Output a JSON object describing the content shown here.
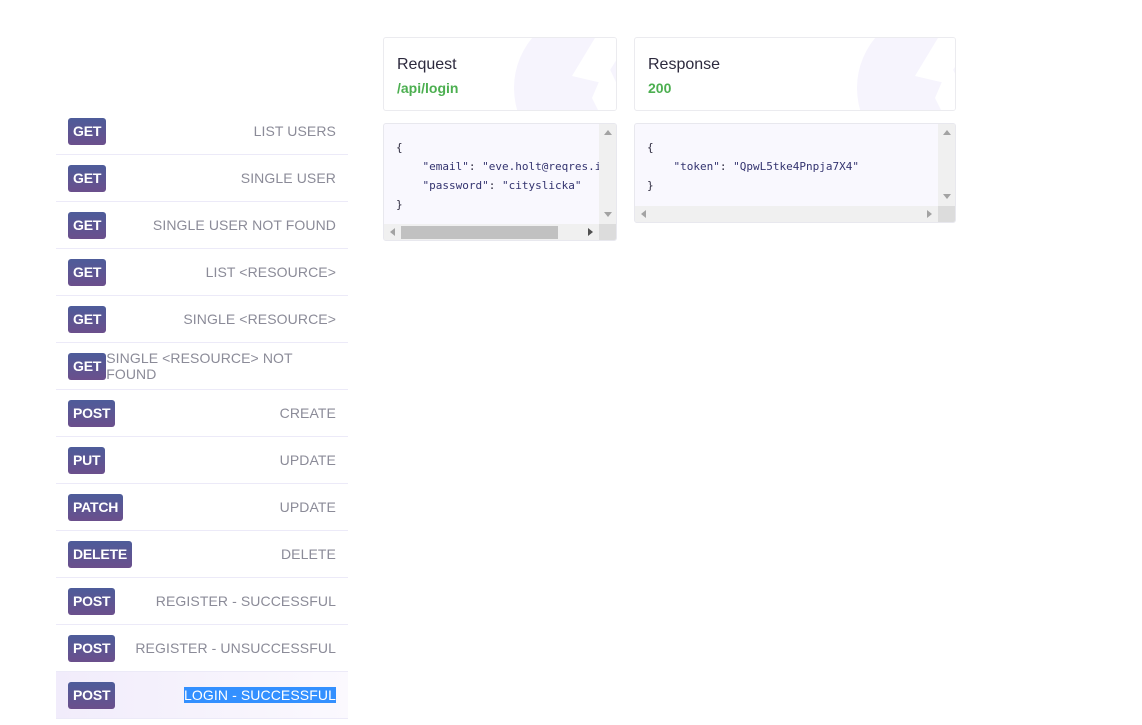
{
  "endpoints": [
    {
      "method": "GET",
      "label": "LIST USERS"
    },
    {
      "method": "GET",
      "label": "SINGLE USER"
    },
    {
      "method": "GET",
      "label": "SINGLE USER NOT FOUND"
    },
    {
      "method": "GET",
      "label": "LIST <RESOURCE>"
    },
    {
      "method": "GET",
      "label": "SINGLE <RESOURCE>"
    },
    {
      "method": "GET",
      "label": "SINGLE <RESOURCE> NOT FOUND"
    },
    {
      "method": "POST",
      "label": "CREATE"
    },
    {
      "method": "PUT",
      "label": "UPDATE"
    },
    {
      "method": "PATCH",
      "label": "UPDATE"
    },
    {
      "method": "DELETE",
      "label": "DELETE"
    },
    {
      "method": "POST",
      "label": "REGISTER - SUCCESSFUL"
    },
    {
      "method": "POST",
      "label": "REGISTER - UNSUCCESSFUL"
    },
    {
      "method": "POST",
      "label": "LOGIN - SUCCESSFUL",
      "active": true
    }
  ],
  "request": {
    "title": "Request",
    "path": "/api/login",
    "body": {
      "open": "{",
      "lines": [
        {
          "key": "\"email\"",
          "value": "\"eve.holt@reqres.i"
        },
        {
          "key": "\"password\"",
          "value": "\"cityslicka\""
        }
      ],
      "close": "}"
    }
  },
  "response": {
    "title": "Response",
    "status": "200",
    "body": {
      "open": "{",
      "lines": [
        {
          "key": "\"token\"",
          "value": "\"QpwL5tke4Pnpja7X4\""
        }
      ],
      "close": "}"
    }
  },
  "colors": {
    "accent_green": "#4caf50",
    "method_badge_top": "#4d5c9a",
    "method_badge_bottom": "#6b4f8c",
    "selection": "#3390ff"
  }
}
